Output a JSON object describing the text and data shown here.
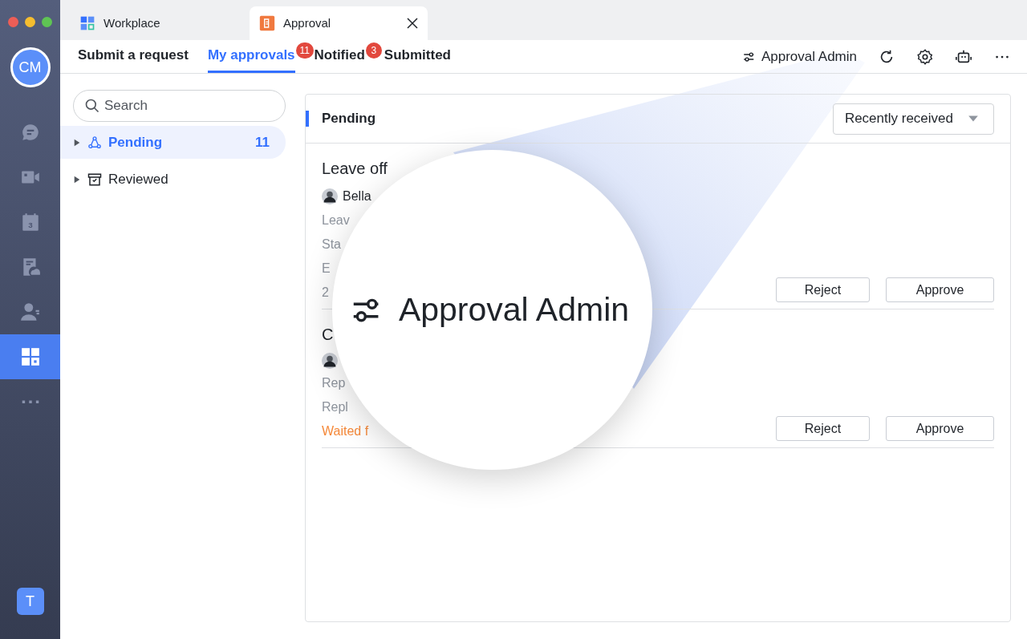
{
  "window": {
    "tabs": [
      {
        "label": "Workplace",
        "selected": false,
        "kind": "workplace",
        "closable": false
      },
      {
        "label": "Approval",
        "selected": true,
        "kind": "approval",
        "closable": true
      }
    ]
  },
  "rail": {
    "avatar": "CM",
    "items": [
      {
        "kind": "chat",
        "selected": false
      },
      {
        "kind": "video",
        "selected": false
      },
      {
        "kind": "calendar",
        "selected": false,
        "text": "3"
      },
      {
        "kind": "docs",
        "selected": false
      },
      {
        "kind": "contacts",
        "selected": false
      },
      {
        "kind": "workplace",
        "selected": true
      },
      {
        "kind": "more",
        "selected": false
      }
    ],
    "workspace": "T"
  },
  "nav": {
    "tabs": [
      {
        "label": "Submit a request",
        "selected": false
      },
      {
        "label": "My approvals",
        "selected": true,
        "badge": "11"
      },
      {
        "label": "Notified",
        "selected": false,
        "badge": "3"
      },
      {
        "label": "Submitted",
        "selected": false
      }
    ],
    "admin_link": "Approval Admin"
  },
  "sidebar": {
    "search": {
      "placeholder": "Search"
    },
    "items": [
      {
        "label": "Pending",
        "kind": "pending",
        "selected": true,
        "expanded": false,
        "count": "11"
      },
      {
        "label": "Reviewed",
        "kind": "reviewed",
        "selected": false,
        "expanded": false
      }
    ]
  },
  "panel": {
    "title": "Pending",
    "sort": "Recently received",
    "requests": [
      {
        "title": "Leave off",
        "requester": "Bella",
        "lines": [
          "Leav",
          "Sta",
          "E",
          "2"
        ],
        "buttons": [
          "Reject",
          "Approve"
        ]
      },
      {
        "title": "C",
        "lines": [
          "Rep",
          "Repl"
        ],
        "status": "Waited f",
        "buttons": [
          "Reject",
          "Approve"
        ]
      }
    ]
  },
  "magnifier": {
    "label": "Approval Admin"
  }
}
